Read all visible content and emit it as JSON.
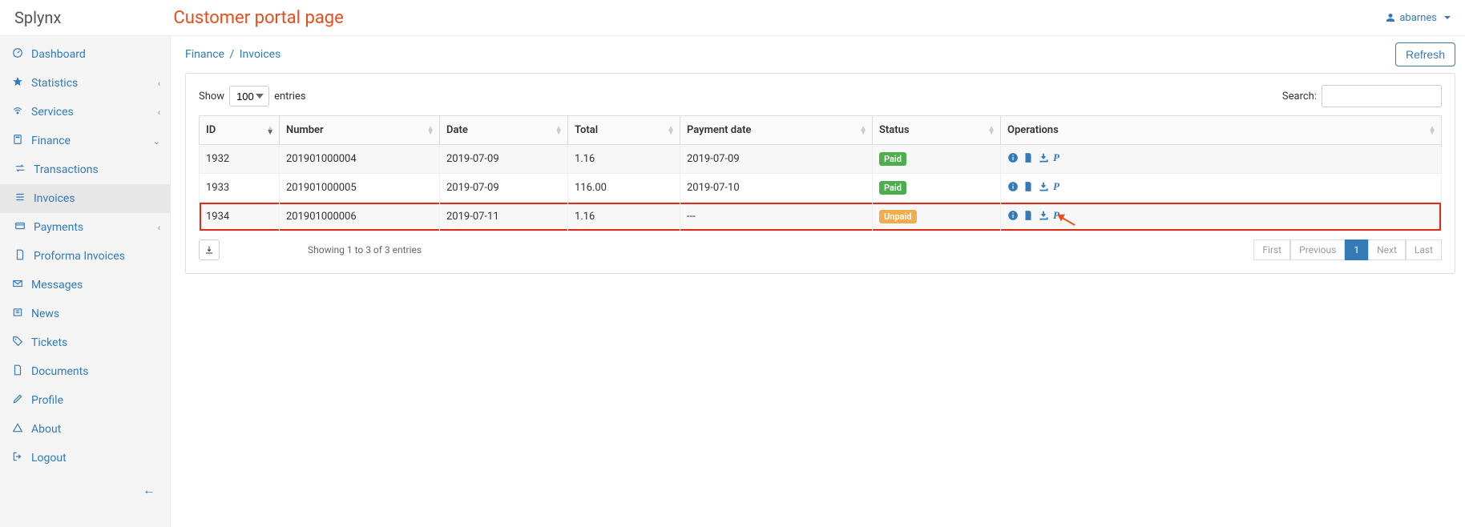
{
  "brand": "Splynx",
  "page_title": "Customer portal page",
  "user": {
    "name": "abarnes"
  },
  "sidebar": {
    "items": [
      {
        "key": "dashboard",
        "icon": "dashboard-icon",
        "label": "Dashboard"
      },
      {
        "key": "statistics",
        "icon": "star-icon",
        "label": "Statistics",
        "expandable": true,
        "open": false
      },
      {
        "key": "services",
        "icon": "wifi-icon",
        "label": "Services",
        "expandable": true,
        "open": false
      },
      {
        "key": "finance",
        "icon": "calculator-icon",
        "label": "Finance",
        "expandable": true,
        "open": true
      },
      {
        "key": "messages",
        "icon": "envelope-icon",
        "label": "Messages"
      },
      {
        "key": "news",
        "icon": "newspaper-icon",
        "label": "News"
      },
      {
        "key": "tickets",
        "icon": "tag-icon",
        "label": "Tickets"
      },
      {
        "key": "documents",
        "icon": "file-icon",
        "label": "Documents"
      },
      {
        "key": "profile",
        "icon": "pencil-icon",
        "label": "Profile"
      },
      {
        "key": "about",
        "icon": "triangle-icon",
        "label": "About"
      },
      {
        "key": "logout",
        "icon": "signout-icon",
        "label": "Logout"
      }
    ],
    "finance_children": [
      {
        "key": "transactions",
        "icon": "exchange-icon",
        "label": "Transactions"
      },
      {
        "key": "invoices",
        "icon": "list-icon",
        "label": "Invoices",
        "active": true
      },
      {
        "key": "payments",
        "icon": "creditcard-icon",
        "label": "Payments",
        "expandable": true,
        "open": false
      },
      {
        "key": "proforma",
        "icon": "file-alt-icon",
        "label": "Proforma Invoices"
      }
    ]
  },
  "breadcrumbs": {
    "part1": "Finance",
    "part2": "Invoices"
  },
  "refresh_label": "Refresh",
  "length": {
    "prefix": "Show",
    "value": "100",
    "suffix": "entries"
  },
  "search": {
    "label": "Search:"
  },
  "columns": {
    "id": "ID",
    "number": "Number",
    "date": "Date",
    "total": "Total",
    "payment_date": "Payment date",
    "status": "Status",
    "operations": "Operations"
  },
  "status_labels": {
    "paid": "Paid",
    "unpaid": "Unpaid"
  },
  "rows": [
    {
      "id": "1932",
      "number": "201901000004",
      "date": "2019-07-09",
      "total": "1.16",
      "payment_date": "2019-07-09",
      "status": "paid"
    },
    {
      "id": "1933",
      "number": "201901000005",
      "date": "2019-07-09",
      "total": "116.00",
      "payment_date": "2019-07-10",
      "status": "paid"
    },
    {
      "id": "1934",
      "number": "201901000006",
      "date": "2019-07-11",
      "total": "1.16",
      "payment_date": "---",
      "status": "unpaid",
      "highlight": true,
      "annotate_pp": true
    }
  ],
  "info_text": "Showing 1 to 3 of 3 entries",
  "pager": {
    "first": "First",
    "prev": "Previous",
    "page": "1",
    "next": "Next",
    "last": "Last"
  }
}
